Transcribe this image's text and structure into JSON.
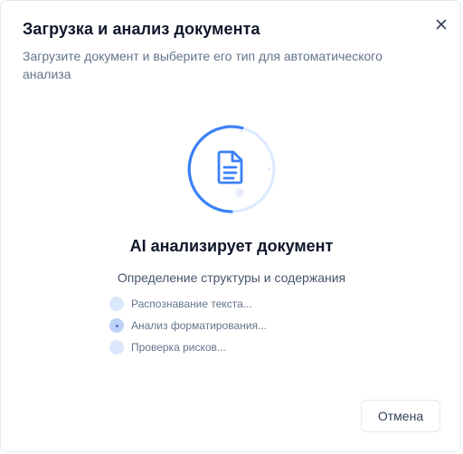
{
  "dialog": {
    "title": "Загрузка и анализ документа",
    "subtitle": "Загрузите документ и выберите его тип для автоматического анализа",
    "close_icon": "close-icon"
  },
  "progress": {
    "icon": "document-icon",
    "heading": "AI анализирует документ",
    "stage": "Определение структуры и содержания",
    "steps": [
      {
        "label": "Распознавание текста...",
        "state": "pending"
      },
      {
        "label": "Анализ форматирования...",
        "state": "active"
      },
      {
        "label": "Проверка рисков...",
        "state": "pending"
      }
    ]
  },
  "footer": {
    "cancel_label": "Отмена"
  },
  "colors": {
    "accent": "#3b82f6",
    "track": "#dbeafe",
    "title": "#0f172a",
    "muted": "#64748b"
  }
}
